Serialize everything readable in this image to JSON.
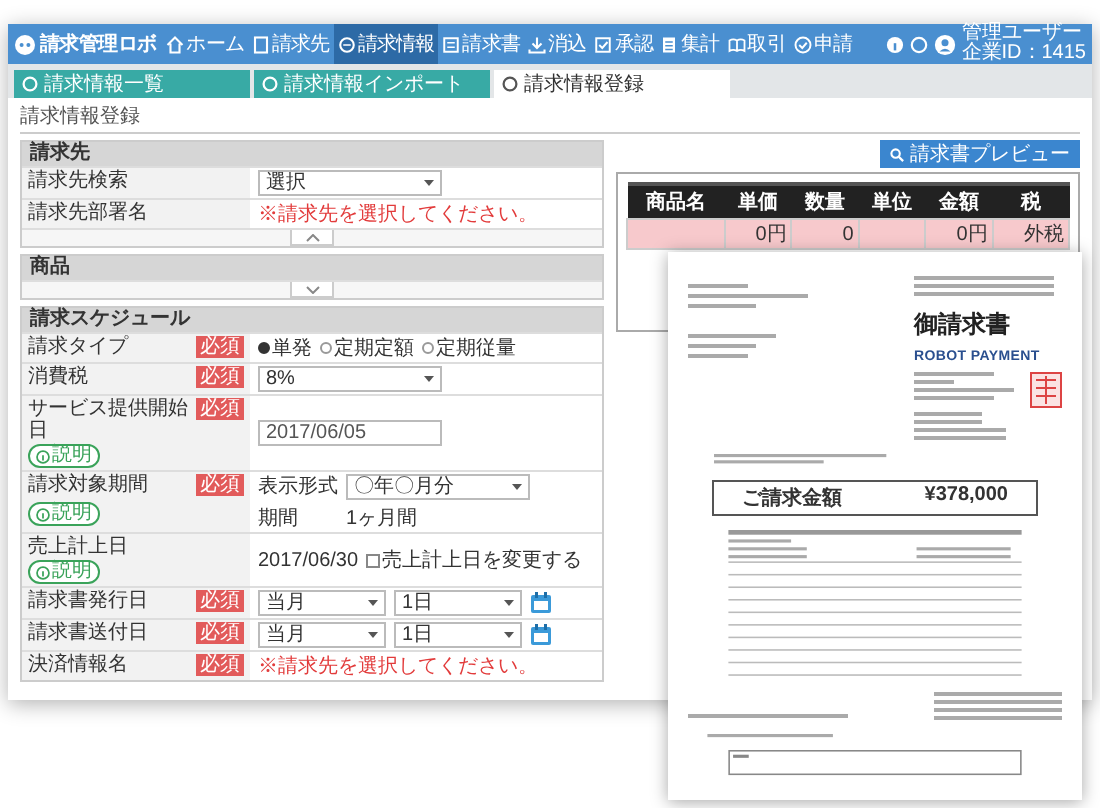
{
  "app_header": {
    "logo": "請求管理ロボ",
    "nav": [
      {
        "label": "ホーム",
        "selected": false
      },
      {
        "label": "請求先",
        "selected": false
      },
      {
        "label": "請求情報",
        "selected": true
      },
      {
        "label": "請求書",
        "selected": false
      },
      {
        "label": "消込",
        "selected": false
      },
      {
        "label": "承認",
        "selected": false
      },
      {
        "label": "集計",
        "selected": false
      },
      {
        "label": "取引",
        "selected": false
      },
      {
        "label": "申請",
        "selected": false
      }
    ],
    "user": {
      "name": "管理ユーザー",
      "company_id": "企業ID：1415"
    }
  },
  "tabs": [
    {
      "label": "請求情報一覧",
      "selected": false
    },
    {
      "label": "請求情報インポート",
      "selected": false
    },
    {
      "label": "請求情報登録",
      "selected": true
    }
  ],
  "page_title": "請求情報登録",
  "sections": [
    {
      "title": "請求先",
      "expanded": true,
      "rows": [
        {
          "label": "請求先検索",
          "kind": "select",
          "value": "選択"
        },
        {
          "label": "請求先部署名",
          "kind": "message",
          "message": "※請求先を選択してください。"
        }
      ]
    },
    {
      "title": "商品",
      "expanded": false
    },
    {
      "title": "請求スケジュール",
      "expanded": true,
      "rows": [
        {
          "label": "請求タイプ",
          "badge": "必須",
          "kind": "radio",
          "options": [
            {
              "label": "単発",
              "selected": true
            },
            {
              "label": "定期定額",
              "selected": false
            },
            {
              "label": "定期従量",
              "selected": false
            }
          ]
        },
        {
          "label": "消費税",
          "badge": "必須",
          "kind": "select",
          "value": "8%"
        },
        {
          "label": "サービス提供開始日",
          "badge": "必須",
          "help": "説明",
          "kind": "text",
          "value": "2017/06/05"
        },
        {
          "label": "請求対象期間",
          "badge": "必須",
          "help": "説明",
          "kind": "period",
          "format_label": "表示形式",
          "format_value": "〇年〇月分",
          "period_label": "期間",
          "period_value": "1ヶ月間"
        },
        {
          "label": "売上計上日",
          "help": "説明",
          "kind": "date_check",
          "value": "2017/06/30",
          "check": {
            "label": "売上計上日を変更する",
            "checked": false
          }
        },
        {
          "label": "請求書発行日",
          "badge": "必須",
          "kind": "select_pair",
          "values": [
            "当月",
            "1日"
          ]
        },
        {
          "label": "請求書送付日",
          "badge": "必須",
          "kind": "select_pair",
          "values": [
            "当月",
            "1日"
          ]
        },
        {
          "label": "決済情報名",
          "badge": "必須",
          "kind": "message",
          "message": "※請求先を選択してください。"
        }
      ]
    }
  ],
  "preview_button": "請求書プレビュー",
  "product_table": {
    "columns": [
      "商品名",
      "単価",
      "数量",
      "単位",
      "金額",
      "税"
    ],
    "rows": [
      [
        "",
        "0円",
        "0",
        "",
        "0円",
        "外税"
      ]
    ]
  },
  "invoice_document": {
    "title": "御請求書",
    "issuer_logo": "ROBOT PAYMENT",
    "amount_label": "ご請求金額",
    "amount": "¥378,000"
  }
}
